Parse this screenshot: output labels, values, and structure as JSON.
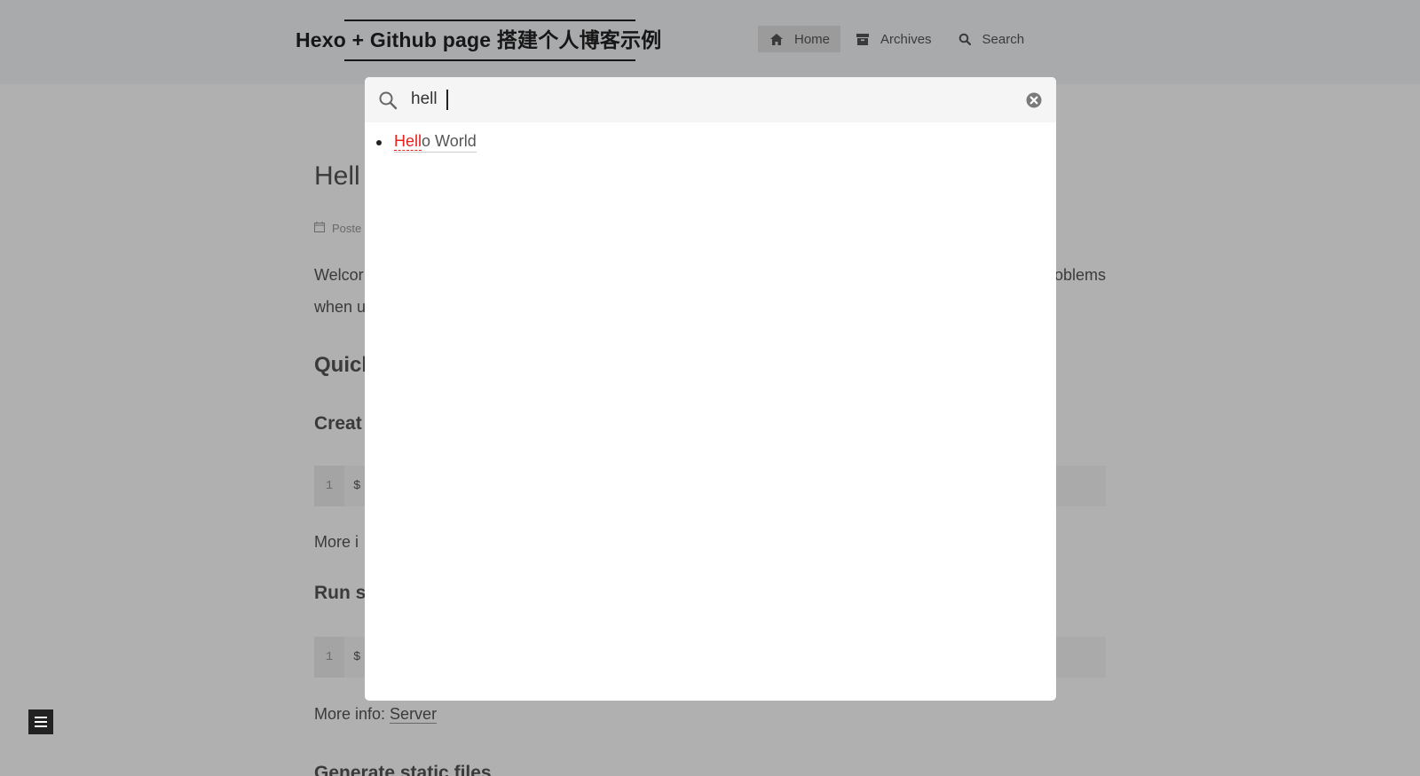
{
  "header": {
    "site_title": "Hexo + Github page 搭建个人博客示例",
    "nav": [
      {
        "label": "Home",
        "icon": "home-icon",
        "active": true
      },
      {
        "label": "Archives",
        "icon": "archive-icon",
        "active": false
      },
      {
        "label": "Search",
        "icon": "search-icon",
        "active": false
      }
    ]
  },
  "post": {
    "title_visible": "Hell",
    "meta_visible": "Poste",
    "para_line1_visible": "Welcor",
    "para_line1_tail": "oblems",
    "para_line2_visible": "when u",
    "h_quick": "Quicl",
    "h_create": "Creat",
    "code1_line_no": "1",
    "code1_text": "$",
    "more_info1_visible": "More i",
    "h_run": "Run s",
    "code2_line_no": "1",
    "code2_text": "$",
    "more_info2_prefix": "More info: ",
    "more_info2_link": "Server",
    "h_generate": "Generate static files"
  },
  "search_popup": {
    "query": "hell",
    "results": [
      {
        "highlight": "Hell",
        "rest": "o World"
      }
    ]
  },
  "colors": {
    "highlight": "#e5211c",
    "header_bg": "#f5f7f9",
    "popup_header_bg": "#f5f5f5"
  }
}
